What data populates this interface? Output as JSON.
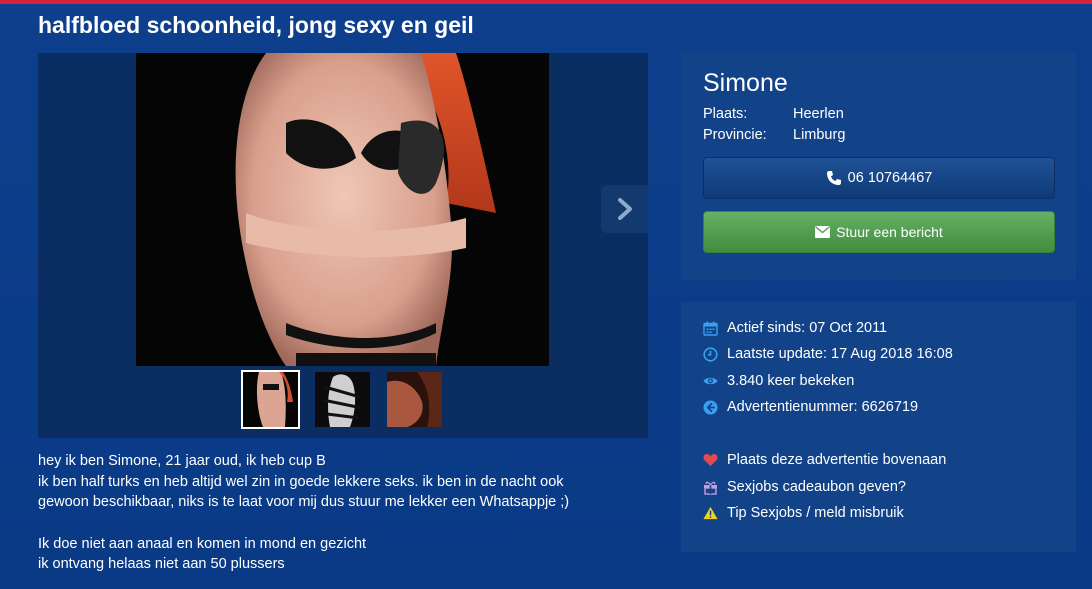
{
  "ad": {
    "title": "halfbloed schoonheid, jong sexy en geil"
  },
  "gallery": {
    "thumb_count": 3
  },
  "description": {
    "lines_1": [
      "hey ik ben Simone, 21 jaar oud, ik heb cup B",
      "ik ben half turks en heb altijd wel zin in goede lekkere seks. ik ben in de nacht ook",
      "gewoon beschikbaar, niks is te laat voor mij dus stuur me lekker een Whatsappje ;)"
    ],
    "lines_2": [
      "Ik doe niet aan anaal en komen in mond en gezicht",
      "ik ontvang helaas niet aan 50 plussers"
    ]
  },
  "profile": {
    "name": "Simone",
    "place_label": "Plaats:",
    "place_value": "Heerlen",
    "province_label": "Provincie:",
    "province_value": "Limburg",
    "phone": "06 10764467",
    "message_button": "Stuur een bericht"
  },
  "stats": {
    "active_since": "Actief sinds: 07 Oct 2011",
    "last_update": "Laatste update: 17 Aug 2018 16:08",
    "views": "3.840 keer bekeken",
    "ad_number": "Advertentienummer: 6626719"
  },
  "actions": {
    "bump": "Plaats deze advertentie bovenaan",
    "gift": "Sexjobs cadeaubon geven?",
    "report": "Tip Sexjobs / meld misbruik"
  },
  "colors": {
    "background": "#0d3f8c",
    "card": "#124389",
    "accent_red": "#d2243a",
    "green_button": "#4f9e4f",
    "icon_blue": "#3aa0f0",
    "heart": "#e5484d",
    "gift": "#c79be0",
    "warning": "#f2d21e"
  },
  "icons": {
    "phone": "phone-icon",
    "envelope": "envelope-icon",
    "calendar": "calendar-icon",
    "clock": "clock-icon",
    "eye": "eye-icon",
    "arrow": "arrow-left-circle-icon",
    "heart": "heart-icon",
    "gift": "gift-icon",
    "warning": "warning-icon",
    "next": "chevron-right-icon"
  }
}
